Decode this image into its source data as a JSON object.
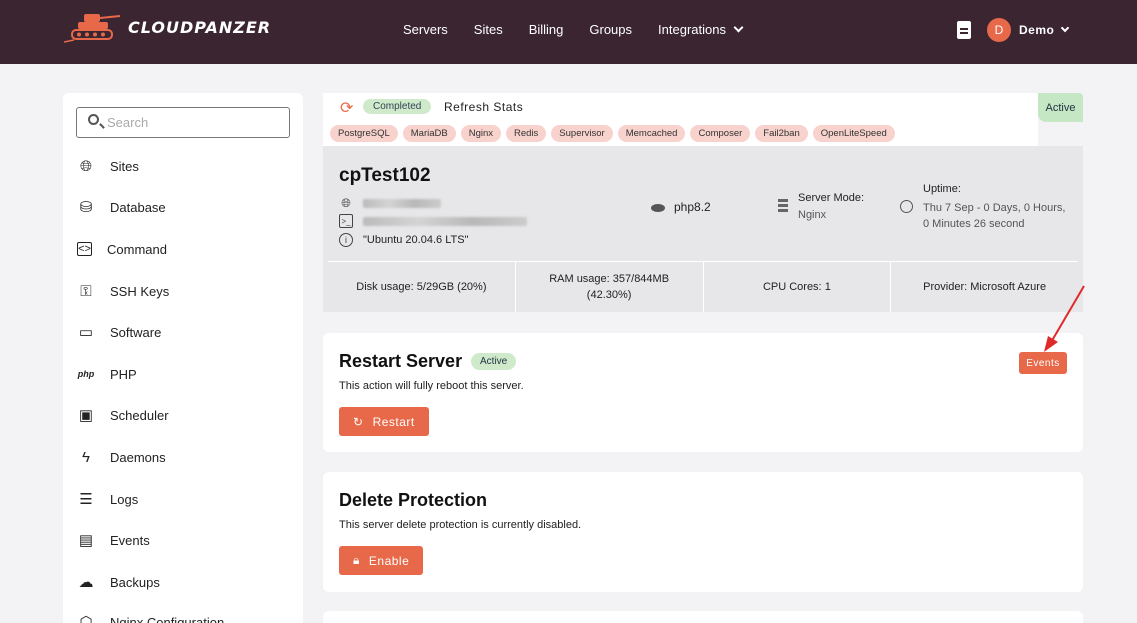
{
  "brand": {
    "name": "CLOUDPANZER"
  },
  "nav": {
    "items": [
      "Servers",
      "Sites",
      "Billing",
      "Groups",
      "Integrations"
    ],
    "user_initial": "D",
    "user_name": "Demo"
  },
  "sidebar": {
    "search_placeholder": "Search",
    "items": [
      {
        "label": "Sites",
        "icon": "globe-icon"
      },
      {
        "label": "Database",
        "icon": "database-icon"
      },
      {
        "label": "Command",
        "icon": "code-icon"
      },
      {
        "label": "SSH Keys",
        "icon": "key-icon"
      },
      {
        "label": "Software",
        "icon": "monitor-icon"
      },
      {
        "label": "PHP",
        "icon": "php-icon"
      },
      {
        "label": "Scheduler",
        "icon": "calendar-clock-icon"
      },
      {
        "label": "Daemons",
        "icon": "bolt-icon"
      },
      {
        "label": "Logs",
        "icon": "log-icon"
      },
      {
        "label": "Events",
        "icon": "list-icon"
      },
      {
        "label": "Backups",
        "icon": "cloud-upload-icon"
      },
      {
        "label": "Nginx Configuration",
        "icon": "nginx-icon"
      }
    ]
  },
  "status": {
    "completed": "Completed",
    "refresh_stats": "Refresh Stats",
    "active": "Active",
    "tags": [
      "PostgreSQL",
      "MariaDB",
      "Nginx",
      "Redis",
      "Supervisor",
      "Memcached",
      "Composer",
      "Fail2ban",
      "OpenLiteSpeed"
    ]
  },
  "server": {
    "name": "cpTest102",
    "os": "\"Ubuntu 20.04.6 LTS\"",
    "php": "php8.2",
    "mode_title": "Server Mode:",
    "mode_value": "Nginx",
    "uptime_title": "Uptime:",
    "uptime_value": "Thu 7 Sep - 0 Days, 0 Hours, 0 Minutes 26 second",
    "stats": [
      {
        "label": "Disk usage:",
        "value": "5/29GB (20%)"
      },
      {
        "label": "RAM usage:",
        "value": "357/844MB (42.30%)"
      },
      {
        "label": "CPU Cores:",
        "value": "1"
      },
      {
        "label": "Provider:",
        "value": "Microsoft Azure"
      }
    ]
  },
  "restart": {
    "title": "Restart Server",
    "badge": "Active",
    "desc": "This action will fully reboot this server.",
    "button": "Restart",
    "events_button": "Events"
  },
  "delete_protection": {
    "title": "Delete Protection",
    "desc": "This server delete protection is currently disabled.",
    "button": "Enable"
  },
  "colors": {
    "accent": "#e8694a",
    "topbar": "#3a2530",
    "success_bg": "#cfeacb"
  }
}
